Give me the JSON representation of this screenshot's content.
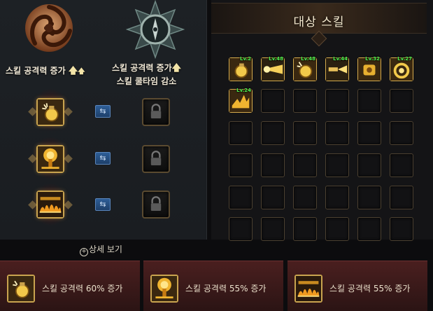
{
  "left": {
    "type1": {
      "label": "스킬 공격력 증가",
      "icon": "swirl-emblem-icon"
    },
    "type2": {
      "label1": "스킬 공격력 증가",
      "label2": "스킬 쿨타임 감소",
      "icon": "compass-emblem-icon"
    },
    "rows": [
      {
        "skill_icon": "grenade-skill-icon",
        "swap_icon": "swap-icon",
        "lock_icon": "lock-icon"
      },
      {
        "skill_icon": "explosion-tree-skill-icon",
        "swap_icon": "swap-icon",
        "lock_icon": "lock-icon"
      },
      {
        "skill_icon": "fire-wall-skill-icon",
        "swap_icon": "swap-icon",
        "lock_icon": "lock-icon"
      }
    ],
    "detail_label": "상세 보기"
  },
  "right": {
    "title": "대상 스킬",
    "filled_skills": [
      {
        "level": "Lv.2",
        "icon": "grenade-skill-icon"
      },
      {
        "level": "Lv.48",
        "icon": "beam-skill-icon"
      },
      {
        "level": "Lv.48",
        "icon": "grenade-skill-icon"
      },
      {
        "level": "Lv.44",
        "icon": "gun-blast-skill-icon"
      },
      {
        "level": "Lv.32",
        "icon": "cannon-skill-icon"
      },
      {
        "level": "Lv.27",
        "icon": "ring-blast-skill-icon"
      },
      {
        "level": "Lv.24",
        "icon": "lightning-skill-icon"
      }
    ],
    "grid": {
      "columns": 6,
      "rows": 6
    }
  },
  "bottom": [
    {
      "text": "스킬 공격력 60% 증가",
      "icon": "grenade-skill-icon"
    },
    {
      "text": "스킬 공격력 55% 증가",
      "icon": "explosion-tree-skill-icon"
    },
    {
      "text": "스킬 공격력 55% 증가",
      "icon": "fire-wall-skill-icon"
    }
  ],
  "colors": {
    "gold": "#c9a44f",
    "level_green": "#4ff04f",
    "swap_blue": "#2e5e97",
    "bottom_red": "#4a1f1f"
  }
}
